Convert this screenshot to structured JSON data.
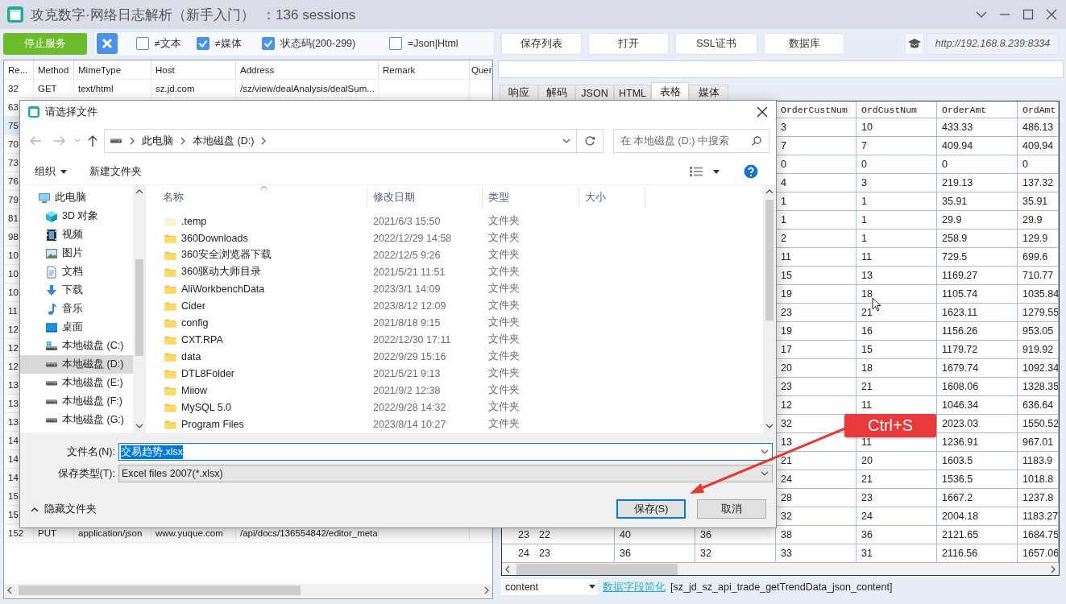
{
  "window": {
    "title": "攻克数字·网络日志解析（新手入门）  ：136 sessions"
  },
  "toolbar": {
    "stop_button": "停止服务",
    "filters": [
      {
        "label": "≠文本",
        "checked": false
      },
      {
        "label": "≠媒体",
        "checked": true
      },
      {
        "label": "状态码(200-299)",
        "checked": true
      },
      {
        "label": "=Json|Html",
        "checked": false
      }
    ],
    "buttons": [
      "保存列表",
      "打开",
      "SSL证书",
      "数据库"
    ],
    "server_url": "http://192.168.8.239:8334"
  },
  "sessions": {
    "columns": [
      "Re...",
      "Method",
      "MimeType",
      "Host",
      "Address",
      "Remark",
      "Quer"
    ],
    "rows": [
      {
        "cells": [
          "32",
          "GET",
          "text/html",
          "sz.jd.com",
          "/sz/view/dealAnalysis/dealSum..."
        ],
        "selected": false
      },
      {
        "cells": [
          "63"
        ],
        "selected": false
      },
      {
        "cells": [
          "75"
        ],
        "selected": true
      },
      {
        "cells": [
          "70"
        ],
        "selected": false
      },
      {
        "cells": [
          "73"
        ],
        "selected": false
      },
      {
        "cells": [
          "76"
        ],
        "selected": false
      },
      {
        "cells": [
          "79"
        ],
        "selected": false
      },
      {
        "cells": [
          "81"
        ],
        "selected": false
      },
      {
        "cells": [
          "98"
        ],
        "selected": false
      },
      {
        "cells": [
          "10"
        ],
        "selected": false
      },
      {
        "cells": [
          "10"
        ],
        "selected": false
      },
      {
        "cells": [
          "10"
        ],
        "selected": false
      },
      {
        "cells": [
          "11"
        ],
        "selected": false
      },
      {
        "cells": [
          "12"
        ],
        "selected": false
      },
      {
        "cells": [
          "12"
        ],
        "selected": false
      },
      {
        "cells": [
          "12"
        ],
        "selected": false
      },
      {
        "cells": [
          "13"
        ],
        "selected": false
      },
      {
        "cells": [
          "13"
        ],
        "selected": false
      },
      {
        "cells": [
          "13"
        ],
        "selected": false
      },
      {
        "cells": [
          "14"
        ],
        "selected": false
      },
      {
        "cells": [
          "14"
        ],
        "selected": false
      },
      {
        "cells": [
          "14"
        ],
        "selected": false
      },
      {
        "cells": [
          "15"
        ],
        "selected": false
      },
      {
        "cells": [
          "15"
        ],
        "selected": false
      },
      {
        "cells": [
          "152",
          "PUT",
          "application/json",
          "www.yuque.com",
          "/api/docs/136554842/editor_meta"
        ],
        "selected": false
      }
    ]
  },
  "detail": {
    "tabs": [
      {
        "label": "响应",
        "selected": false
      },
      {
        "label": "解码",
        "selected": false
      },
      {
        "label": "JSON",
        "selected": false
      },
      {
        "label": "HTML",
        "selected": false
      },
      {
        "label": "表格",
        "selected": true
      },
      {
        "label": "媒体",
        "selected": false
      }
    ],
    "table": {
      "columns": [
        "OrderCustNum",
        "OrdCustNum",
        "OrderAmt",
        "OrdAmt"
      ],
      "rows": [
        {
          "cells": [
            "3",
            "10",
            "433.33",
            "486.13"
          ]
        },
        {
          "cells": [
            "7",
            "7",
            "409.94",
            "409.94"
          ]
        },
        {
          "cells": [
            "0",
            "0",
            "0",
            "0"
          ]
        },
        {
          "cells": [
            "4",
            "3",
            "219.13",
            "137.32"
          ]
        },
        {
          "cells": [
            "1",
            "1",
            "35.91",
            "35.91"
          ]
        },
        {
          "cells": [
            "1",
            "1",
            "29.9",
            "29.9"
          ]
        },
        {
          "cells": [
            "2",
            "1",
            "258.9",
            "129.9"
          ]
        },
        {
          "cells": [
            "11",
            "11",
            "729.5",
            "699.6"
          ]
        },
        {
          "cells": [
            "15",
            "13",
            "1169.27",
            "710.77"
          ]
        },
        {
          "cells": [
            "19",
            "18",
            "1105.74",
            "1035.84"
          ]
        },
        {
          "cells": [
            "23",
            "21",
            "1623.11",
            "1279.55"
          ]
        },
        {
          "cells": [
            "19",
            "16",
            "1156.26",
            "953.05"
          ]
        },
        {
          "cells": [
            "17",
            "15",
            "1179.72",
            "919.92"
          ]
        },
        {
          "cells": [
            "20",
            "18",
            "1679.74",
            "1092.34"
          ]
        },
        {
          "cells": [
            "23",
            "21",
            "1608.06",
            "1328.35"
          ]
        },
        {
          "cells": [
            "12",
            "11",
            "1046.34",
            "636.64"
          ]
        },
        {
          "cells": [
            "32",
            null,
            "2023.03",
            "1550.52"
          ]
        },
        {
          "cells": [
            "13",
            "11",
            "1236.91",
            "967.01"
          ]
        },
        {
          "cells": [
            "21",
            "20",
            "1603.5",
            "1183.9"
          ]
        },
        {
          "cells": [
            "24",
            "21",
            "1536.5",
            "1018.8"
          ]
        },
        {
          "cells": [
            "28",
            "23",
            "1667.2",
            "1237.8"
          ]
        },
        {
          "cells": [
            "32",
            "24",
            "2004.18",
            "1183.27"
          ]
        },
        {
          "index": "23",
          "cells": [
            "22",
            "40",
            "36",
            "38",
            "36",
            "2121.65",
            "1684.75"
          ]
        },
        {
          "index": "24",
          "cells": [
            "23",
            "36",
            "32",
            "33",
            "31",
            "2116.56",
            "1657.06"
          ]
        }
      ]
    },
    "field_select": "content",
    "link": "数据字段简化",
    "source": "[sz_jd_sz_api_trade_getTrendData_json_content]"
  },
  "dialog": {
    "title": "请选择文件",
    "path": [
      "此电脑",
      "本地磁盘 (D:)"
    ],
    "search": {
      "placeholder": "在 本地磁盘 (D:) 中搜索"
    },
    "commands": [
      "组织",
      "新建文件夹"
    ],
    "tree": [
      {
        "label": "此电脑",
        "kind": "computer",
        "selected": false,
        "children": [
          {
            "label": "3D 对象",
            "kind": "objects",
            "selected": false
          },
          {
            "label": "视频",
            "kind": "videos",
            "selected": false
          },
          {
            "label": "图片",
            "kind": "pictures",
            "selected": false
          },
          {
            "label": "文档",
            "kind": "documents",
            "selected": false
          },
          {
            "label": "下载",
            "kind": "downloads",
            "selected": false
          },
          {
            "label": "音乐",
            "kind": "music",
            "selected": false
          },
          {
            "label": "桌面",
            "kind": "desktop",
            "selected": false
          },
          {
            "label": "本地磁盘 (C:)",
            "kind": "system_drive",
            "selected": false
          },
          {
            "label": "本地磁盘 (D:)",
            "kind": "drive",
            "selected": true
          },
          {
            "label": "本地磁盘 (E:)",
            "kind": "drive",
            "selected": false
          },
          {
            "label": "本地磁盘 (F:)",
            "kind": "drive",
            "selected": false
          },
          {
            "label": "本地磁盘 (G:)",
            "kind": "drive",
            "selected": false
          }
        ]
      }
    ],
    "columns": [
      "名称",
      "修改日期",
      "类型",
      "大小"
    ],
    "files": [
      {
        "name": ".temp",
        "modified": "2021/6/3 15:50",
        "type": "文件夹",
        "hidden": true
      },
      {
        "name": "360Downloads",
        "modified": "2022/12/29 14:58",
        "type": "文件夹",
        "hidden": false
      },
      {
        "name": "360安全浏览器下载",
        "modified": "2022/12/5 9:26",
        "type": "文件夹",
        "hidden": false
      },
      {
        "name": "360驱动大师目录",
        "modified": "2021/5/21 11:51",
        "type": "文件夹",
        "hidden": false
      },
      {
        "name": "AliWorkbenchData",
        "modified": "2023/3/1 14:09",
        "type": "文件夹",
        "hidden": false
      },
      {
        "name": "Cider",
        "modified": "2023/8/12 12:09",
        "type": "文件夹",
        "hidden": false
      },
      {
        "name": "config",
        "modified": "2021/8/18 9:15",
        "type": "文件夹",
        "hidden": false
      },
      {
        "name": "CXT.RPA",
        "modified": "2022/12/30 17:11",
        "type": "文件夹",
        "hidden": false
      },
      {
        "name": "data",
        "modified": "2022/9/29 15:16",
        "type": "文件夹",
        "hidden": false
      },
      {
        "name": "DTL8Folder",
        "modified": "2021/5/21 9:13",
        "type": "文件夹",
        "hidden": false
      },
      {
        "name": "Miiow",
        "modified": "2021/9/2 12:38",
        "type": "文件夹",
        "hidden": false
      },
      {
        "name": "MySQL 5.0",
        "modified": "2022/9/28 14:32",
        "type": "文件夹",
        "hidden": false
      },
      {
        "name": "Program Files",
        "modified": "2023/8/14 10:27",
        "type": "文件夹",
        "hidden": false
      }
    ],
    "file_name": {
      "label": "文件名(N):",
      "value": "交易趋势.xlsx",
      "text_selected": true
    },
    "file_type": {
      "label": "保存类型(T):",
      "value": "Excel files 2007(*.xlsx)"
    },
    "hide_folders": "隐藏文件夹",
    "buttons": [
      {
        "label": "保存(S)",
        "default": true
      },
      {
        "label": "取消",
        "default": false
      }
    ]
  },
  "callout": "Ctrl+S"
}
